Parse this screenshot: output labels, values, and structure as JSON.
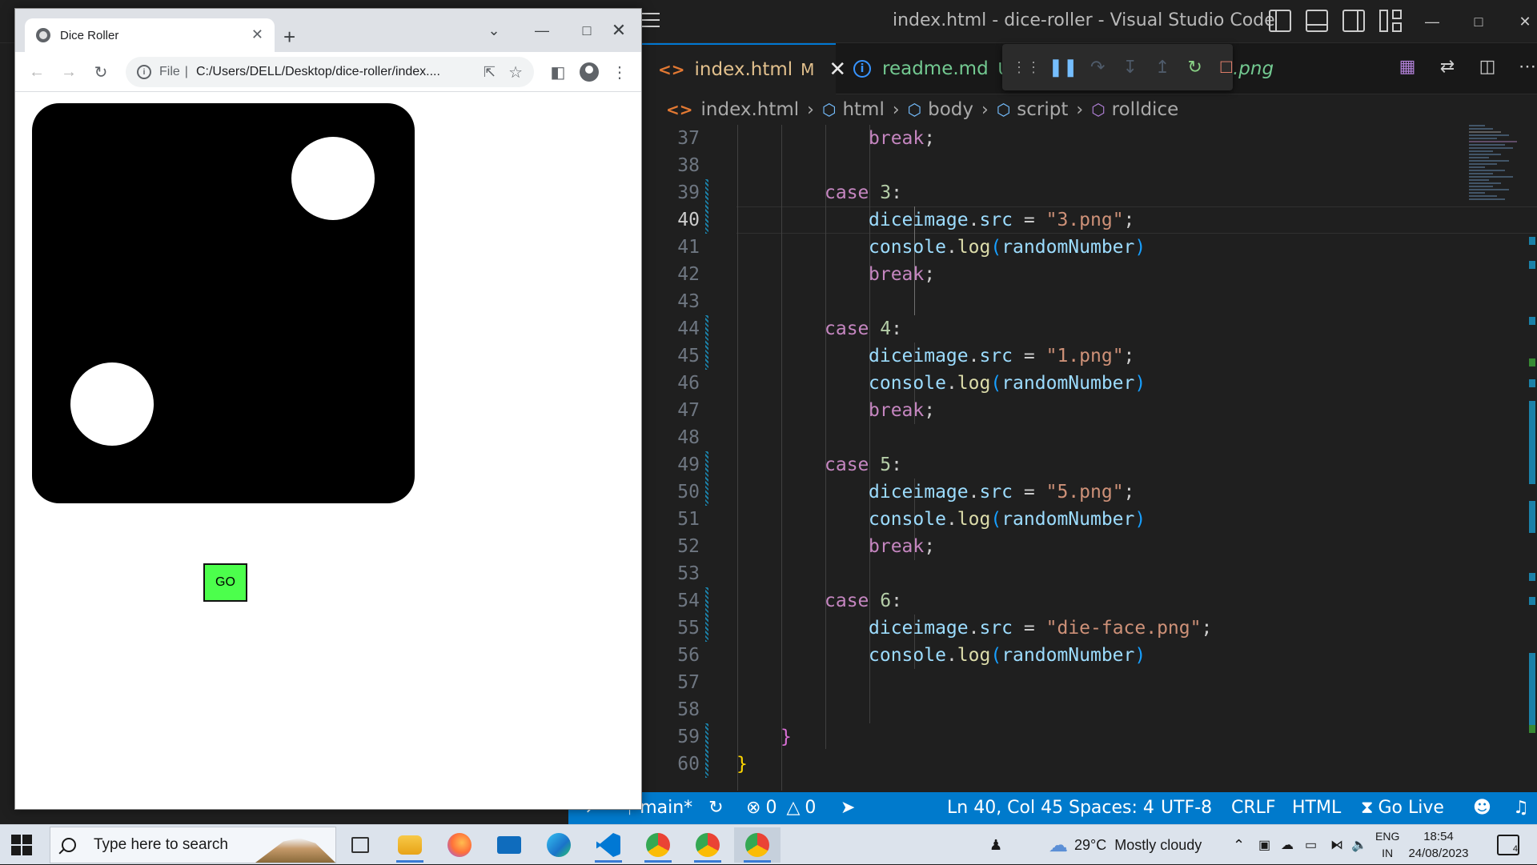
{
  "vscode": {
    "title": "index.html - dice-roller - Visual Studio Code",
    "tabs": [
      {
        "label": "index.html",
        "badge": "M"
      },
      {
        "label": "readme.md",
        "badge": "U"
      }
    ],
    "hidden_tab_fragment": ".png",
    "breadcrumb": [
      "index.html",
      "html",
      "body",
      "script",
      "rolldice"
    ],
    "code_lines": [
      {
        "n": "37",
        "text": "break;"
      },
      {
        "n": "38",
        "text": ""
      },
      {
        "n": "39",
        "text": "case 3:"
      },
      {
        "n": "40",
        "text": "diceimage.src = \"3.png\";"
      },
      {
        "n": "41",
        "text": "console.log(randomNumber)"
      },
      {
        "n": "42",
        "text": "break;"
      },
      {
        "n": "43",
        "text": ""
      },
      {
        "n": "44",
        "text": "case 4:"
      },
      {
        "n": "45",
        "text": "diceimage.src = \"1.png\";"
      },
      {
        "n": "46",
        "text": "console.log(randomNumber)"
      },
      {
        "n": "47",
        "text": "break;"
      },
      {
        "n": "48",
        "text": ""
      },
      {
        "n": "49",
        "text": "case 5:"
      },
      {
        "n": "50",
        "text": "diceimage.src = \"5.png\";"
      },
      {
        "n": "51",
        "text": "console.log(randomNumber)"
      },
      {
        "n": "52",
        "text": "break;"
      },
      {
        "n": "53",
        "text": ""
      },
      {
        "n": "54",
        "text": "case 6:"
      },
      {
        "n": "55",
        "text": "diceimage.src = \"die-face.png\";"
      },
      {
        "n": "56",
        "text": "console.log(randomNumber)"
      },
      {
        "n": "57",
        "text": ""
      },
      {
        "n": "58",
        "text": ""
      },
      {
        "n": "59",
        "text": "}"
      },
      {
        "n": "60",
        "text": "}"
      }
    ],
    "current_line": "40",
    "status": {
      "branch": "main*",
      "errors": "0",
      "warnings": "0",
      "position": "Ln 40, Col 45",
      "spaces": "Spaces: 4",
      "encoding": "UTF-8",
      "eol": "CRLF",
      "language": "HTML",
      "golive": "Go Live"
    },
    "colors": {
      "statusbar": "#007acc",
      "editor_bg": "#1f1f1f",
      "keyword": "#c586c0",
      "string": "#ce9178",
      "variable": "#9cdcfe",
      "function": "#dcdcaa"
    }
  },
  "chrome": {
    "tab_title": "Dice Roller",
    "url_scheme": "File",
    "url": "C:/Users/DELL/Desktop/dice-roller/index....",
    "go_label": "GO",
    "die_face_value": 2,
    "colors": {
      "go_button": "#4cff4c",
      "die": "#000000",
      "pip": "#ffffff"
    }
  },
  "taskbar": {
    "search_placeholder": "Type here to search",
    "weather_temp": "29°C",
    "weather_text": "Mostly cloudy",
    "lang_1": "ENG",
    "lang_2": "IN",
    "time": "18:54",
    "date": "24/08/2023",
    "notification_count": "4",
    "apps": [
      "task-view-icon",
      "file-explorer-icon",
      "firefox-icon",
      "mail-icon",
      "edge-icon",
      "vscode-icon",
      "chrome-profile-icon",
      "chrome-profile-p-icon",
      "chrome-icon"
    ]
  }
}
